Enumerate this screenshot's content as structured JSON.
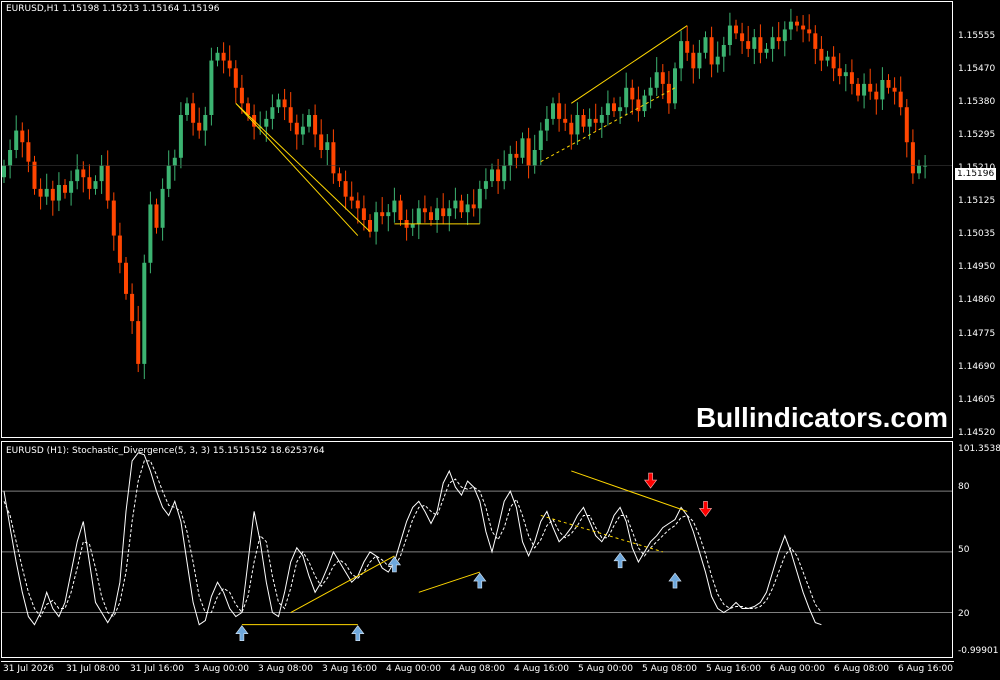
{
  "window": {
    "chart_title": "EURUSD,H1  1.15198 1.15213 1.15164 1.15196",
    "indicator_title": "EURUSD (H1):  Stochastic_Divergence(5, 3, 3) 15.1515152 18.6253764",
    "watermark": "Bullindicators.com",
    "current_price": "1.15196"
  },
  "colors": {
    "background": "#000000",
    "bull": "#3cb371",
    "bear": "#ff4500",
    "divergence": "#ffd700",
    "level_line": "#808080",
    "stoch_main": "#ffffff",
    "stoch_signal": "#ffffff",
    "arrow_up": "#6fa8dc",
    "arrow_down": "#ff0000"
  },
  "price_axis": [
    "1.15555",
    "1.15470",
    "1.15380",
    "1.15295",
    "1.15210",
    "1.15125",
    "1.15035",
    "1.14950",
    "1.14860",
    "1.14775",
    "1.14690",
    "1.14605",
    "1.14520"
  ],
  "indicator_axis": [
    "101.35381",
    "80",
    "50",
    "20",
    "-0.99901"
  ],
  "time_axis": [
    "31 Jul 2026",
    "31 Jul 08:00",
    "31 Jul 16:00",
    "3 Aug 00:00",
    "3 Aug 08:00",
    "3 Aug 16:00",
    "4 Aug 00:00",
    "4 Aug 08:00",
    "4 Aug 16:00",
    "5 Aug 00:00",
    "5 Aug 08:00",
    "5 Aug 16:00",
    "6 Aug 00:00",
    "6 Aug 08:00",
    "6 Aug 16:00"
  ],
  "chart_data": [
    {
      "type": "candlestick",
      "symbol": "EURUSD",
      "timeframe": "H1",
      "ylim": [
        1.1452,
        1.156
      ],
      "closes": [
        1.152,
        1.1524,
        1.1529,
        1.1526,
        1.1521,
        1.1514,
        1.1512,
        1.1514,
        1.1511,
        1.1515,
        1.1513,
        1.1516,
        1.1519,
        1.1517,
        1.1514,
        1.1516,
        1.152,
        1.1511,
        1.1502,
        1.1495,
        1.1487,
        1.148,
        1.1469,
        1.1495,
        1.151,
        1.1504,
        1.1514,
        1.152,
        1.1522,
        1.1533,
        1.1536,
        1.1531,
        1.1529,
        1.1533,
        1.1547,
        1.1549,
        1.1547,
        1.1545,
        1.154,
        1.1536,
        1.1533,
        1.153,
        1.153,
        1.1532,
        1.1535,
        1.1537,
        1.1535,
        1.1531,
        1.1528,
        1.153,
        1.1533,
        1.1528,
        1.1524,
        1.1526,
        1.1518,
        1.1516,
        1.1512,
        1.1511,
        1.1509,
        1.1506,
        1.1503,
        1.1508,
        1.1507,
        1.1508,
        1.1511,
        1.1506,
        1.1504,
        1.1505,
        1.1509,
        1.1508,
        1.1506,
        1.1509,
        1.1507,
        1.1509,
        1.1511,
        1.1508,
        1.151,
        1.1509,
        1.1514,
        1.1516,
        1.1519,
        1.1516,
        1.152,
        1.1523,
        1.1522,
        1.1527,
        1.152,
        1.1524,
        1.1529,
        1.1532,
        1.1536,
        1.1532,
        1.1531,
        1.1528,
        1.1533,
        1.153,
        1.1532,
        1.1531,
        1.1533,
        1.1536,
        1.1534,
        1.1535,
        1.154,
        1.1537,
        1.1534,
        1.1538,
        1.154,
        1.1544,
        1.1541,
        1.1536,
        1.1545,
        1.1552,
        1.1549,
        1.1545,
        1.1549,
        1.1553,
        1.1546,
        1.1548,
        1.1551,
        1.1556,
        1.1554,
        1.1552,
        1.155,
        1.1553,
        1.1549,
        1.155,
        1.1553,
        1.1552,
        1.1555,
        1.1557,
        1.1556,
        1.1555,
        1.1554,
        1.155,
        1.1547,
        1.1548,
        1.1545,
        1.1543,
        1.1544,
        1.1541,
        1.1538,
        1.1541,
        1.1539,
        1.1537,
        1.1542,
        1.154,
        1.1539,
        1.1535,
        1.1526,
        1.1518,
        1.152,
        1.152
      ]
    },
    {
      "type": "line",
      "title": "Stochastic_Divergence(5, 3, 3)",
      "ylim": [
        -0.99901,
        101.35381
      ],
      "levels": [
        20,
        50,
        80
      ],
      "series": [
        {
          "name": "main",
          "values": [
            80,
            62,
            45,
            30,
            18,
            14,
            20,
            30,
            22,
            18,
            25,
            40,
            55,
            65,
            45,
            25,
            20,
            15,
            20,
            35,
            70,
            95,
            99,
            98,
            90,
            80,
            72,
            68,
            75,
            65,
            45,
            25,
            14,
            16,
            28,
            35,
            30,
            22,
            18,
            20,
            45,
            70,
            55,
            35,
            20,
            18,
            30,
            45,
            52,
            48,
            38,
            30,
            35,
            42,
            50,
            45,
            40,
            35,
            38,
            45,
            50,
            48,
            42,
            40,
            45,
            55,
            65,
            72,
            75,
            70,
            64,
            70,
            84,
            90,
            82,
            78,
            85,
            82,
            75,
            60,
            50,
            62,
            75,
            80,
            72,
            55,
            48,
            55,
            65,
            70,
            62,
            55,
            58,
            62,
            68,
            72,
            65,
            58,
            55,
            60,
            68,
            72,
            65,
            52,
            45,
            50,
            55,
            58,
            62,
            64,
            66,
            72,
            68,
            60,
            50,
            40,
            28,
            22,
            20,
            22,
            25,
            22,
            22,
            23,
            25,
            30,
            40,
            50,
            58,
            50,
            40,
            30,
            22,
            15,
            14
          ]
        },
        {
          "name": "signal",
          "values": [
            75,
            68,
            55,
            42,
            30,
            22,
            18,
            24,
            26,
            22,
            22,
            30,
            42,
            55,
            54,
            42,
            28,
            20,
            18,
            25,
            40,
            65,
            85,
            95,
            95,
            88,
            80,
            73,
            72,
            70,
            60,
            45,
            28,
            20,
            20,
            28,
            32,
            30,
            24,
            20,
            28,
            45,
            58,
            55,
            38,
            25,
            22,
            32,
            45,
            50,
            45,
            38,
            33,
            37,
            43,
            46,
            44,
            39,
            37,
            40,
            45,
            48,
            46,
            43,
            42,
            48,
            57,
            66,
            72,
            73,
            70,
            68,
            76,
            84,
            86,
            82,
            81,
            82,
            80,
            72,
            60,
            56,
            62,
            72,
            76,
            68,
            58,
            52,
            56,
            63,
            66,
            60,
            57,
            59,
            63,
            68,
            68,
            62,
            57,
            57,
            63,
            68,
            68,
            60,
            52,
            48,
            52,
            55,
            58,
            61,
            63,
            67,
            68,
            65,
            58,
            49,
            38,
            29,
            24,
            22,
            23,
            23,
            22,
            22,
            23,
            26,
            32,
            40,
            48,
            52,
            48,
            40,
            32,
            24,
            20
          ]
        }
      ]
    }
  ]
}
